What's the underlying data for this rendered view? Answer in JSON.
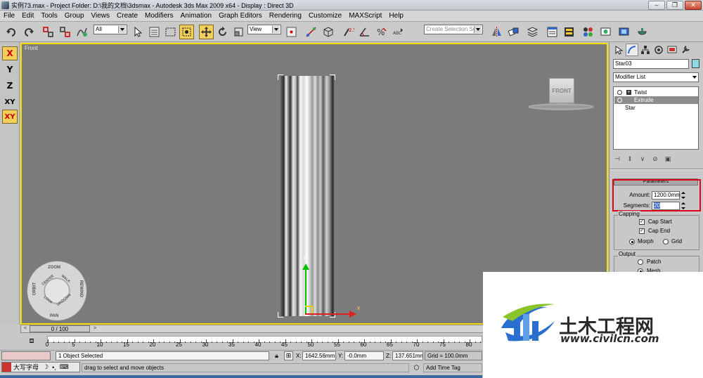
{
  "window": {
    "title": "实例73.max    - Project Folder: D:\\我的文档\\3dsmax      - Autodesk 3ds Max  2009 x64      - Display : Direct 3D",
    "minimize": "–",
    "restore": "❐",
    "close": "✕"
  },
  "menu": [
    "File",
    "Edit",
    "Tools",
    "Group",
    "Views",
    "Create",
    "Modifiers",
    "Animation",
    "Graph Editors",
    "Rendering",
    "Customize",
    "MAXScript",
    "Help"
  ],
  "toolbar": {
    "filter_value": "All",
    "coord_value": "View",
    "selection_set_placeholder": "Create Selection Set"
  },
  "axis": {
    "x": "X",
    "y": "Y",
    "z": "Z",
    "xy": "XY",
    "xy2": "XY"
  },
  "viewport": {
    "label": "Front",
    "viewcube_face": "FRONT",
    "gizmo_x": "x",
    "gizmo_y": "y",
    "nav_wheel": {
      "zoom": "ZOOM",
      "orbit": "ORBIT",
      "pan": "PAN",
      "rewind": "REWIND",
      "center": "CENTER",
      "walk": "WALK",
      "look": "LOOK",
      "updown": "UP/DOWN"
    }
  },
  "command_panel": {
    "object_name": "Star03",
    "object_color": "#8fd8e8",
    "modifier_list": "Modifier List",
    "stack": [
      "Twist",
      "Extrude",
      "Star"
    ],
    "parameters_title": "Parameters",
    "amount_label": "Amount:",
    "amount_value": "1200.0mm",
    "segments_label": "Segments:",
    "segments_value": "20",
    "capping_label": "Capping",
    "cap_start": "Cap Start",
    "cap_end": "Cap End",
    "morph": "Morph",
    "grid": "Grid",
    "output_label": "Output",
    "patch": "Patch",
    "mesh": "Mesh"
  },
  "timeline": {
    "frame": "0 / 100",
    "prev": "<",
    "next": ">",
    "ticks": [
      "0",
      "5",
      "10",
      "15",
      "20",
      "25",
      "30",
      "35",
      "40",
      "45",
      "50",
      "55",
      "60",
      "65",
      "70",
      "75",
      "80"
    ]
  },
  "status": {
    "selection": "1 Object Selected",
    "prompt": "drag to select and move objects",
    "x_label": "X:",
    "x_value": "1642.56mm",
    "y_label": "Y:",
    "y_value": "-0.0mm",
    "z_label": "Z:",
    "z_value": "137.651mm",
    "grid": "Grid = 100.0mm",
    "add_time_tag": "Add Time Tag",
    "ime_text": "大写字母"
  },
  "watermark": {
    "text": "土木工程网",
    "url": "www.civilcn.com"
  }
}
